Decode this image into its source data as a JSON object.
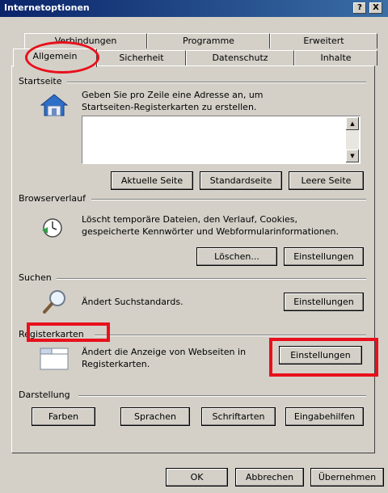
{
  "window": {
    "title": "Internetoptionen",
    "help_btn": "?",
    "close_btn": "X"
  },
  "tabs": {
    "row1": [
      "Verbindungen",
      "Programme",
      "Erweitert"
    ],
    "row2": [
      "Allgemein",
      "Sicherheit",
      "Datenschutz",
      "Inhalte"
    ],
    "active": "Allgemein"
  },
  "startseite": {
    "heading": "Startseite",
    "description_line1": "Geben Sie pro Zeile eine Adresse an, um",
    "description_line2": "Startseiten-Registerkarten zu erstellen.",
    "input_value": "",
    "btn_current": "Aktuelle Seite",
    "btn_default": "Standardseite",
    "btn_empty": "Leere Seite"
  },
  "verlauf": {
    "heading": "Browserverlauf",
    "description_line1": "Löscht temporäre Dateien, den Verlauf, Cookies,",
    "description_line2": "gespeicherte Kennwörter und Webformularinformationen.",
    "btn_delete": "Löschen...",
    "btn_settings": "Einstellungen"
  },
  "suchen": {
    "heading": "Suchen",
    "description": "Ändert Suchstandards.",
    "btn_settings": "Einstellungen"
  },
  "register": {
    "heading": "Registerkarten",
    "description_line1": "Ändert die Anzeige von Webseiten in",
    "description_line2": "Registerkarten.",
    "btn_settings": "Einstellungen"
  },
  "darstellung": {
    "heading": "Darstellung",
    "btn_colors": "Farben",
    "btn_languages": "Sprachen",
    "btn_fonts": "Schriftarten",
    "btn_access": "Eingabehilfen"
  },
  "footer": {
    "ok": "OK",
    "cancel": "Abbrechen",
    "apply": "Übernehmen"
  },
  "highlight_color": "#e8101c"
}
